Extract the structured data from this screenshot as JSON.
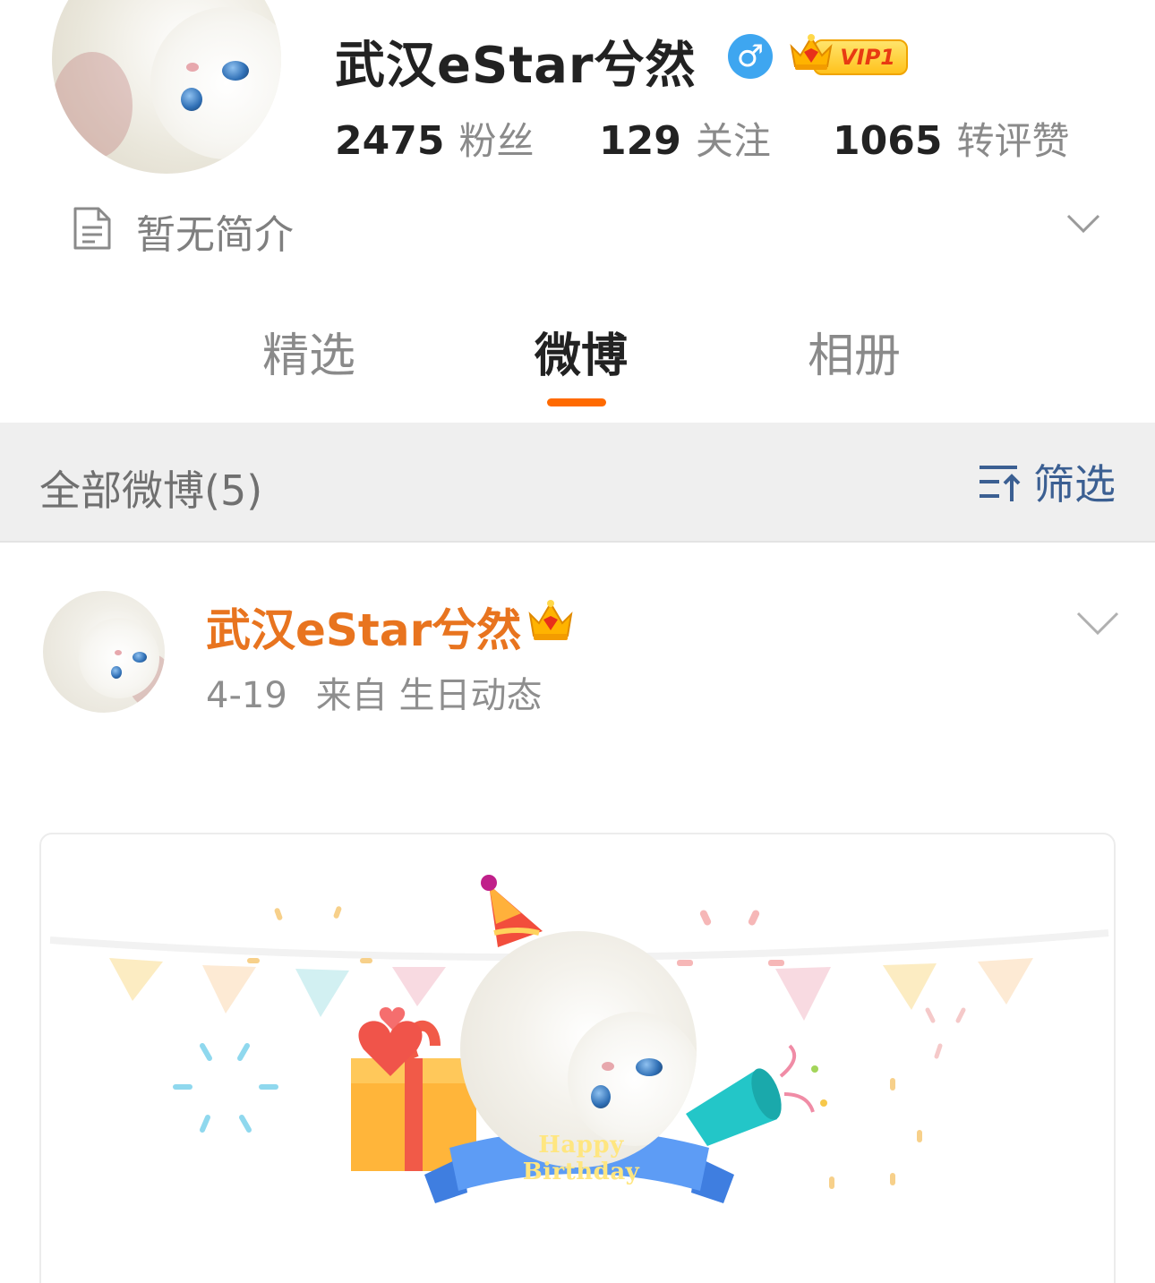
{
  "profile": {
    "name": "武汉eStar兮然",
    "gender_icon": "male-icon",
    "vip_label": "VIP1",
    "stats": [
      {
        "value": "2475",
        "label": "粉丝"
      },
      {
        "value": "129",
        "label": "关注"
      },
      {
        "value": "1065",
        "label": "转评赞"
      }
    ],
    "bio": "暂无简介"
  },
  "tabs": [
    {
      "label": "精选",
      "active": false
    },
    {
      "label": "微博",
      "active": true
    },
    {
      "label": "相册",
      "active": false
    }
  ],
  "filter_bar": {
    "title": "全部微博(5)",
    "filter_label": "筛选"
  },
  "post": {
    "author": "武汉eStar兮然",
    "date": "4-19",
    "source": "来自 生日动态",
    "card_banner_text": "Happy Birthday"
  },
  "colors": {
    "accent_orange": "#ff6a00",
    "author_orange": "#e8741f",
    "filter_blue": "#3b5f92",
    "gender_blue": "#3ea6f0"
  }
}
